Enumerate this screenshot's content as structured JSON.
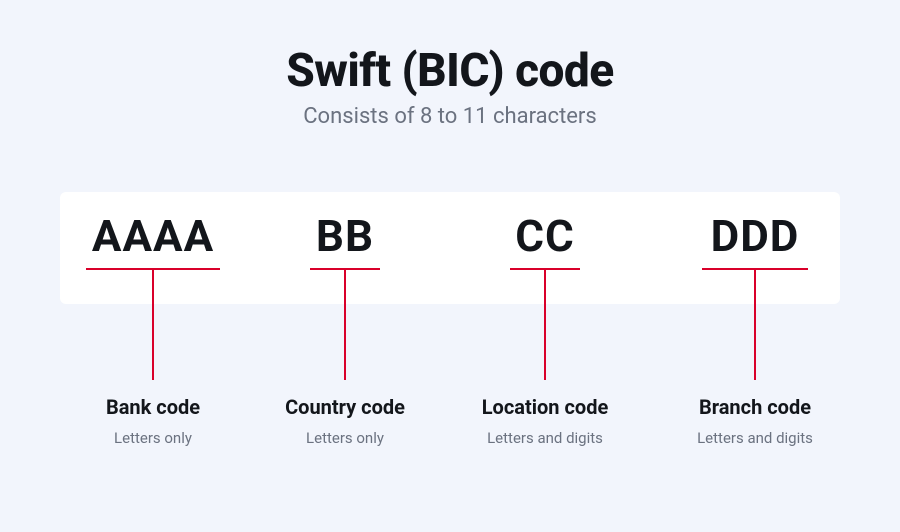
{
  "header": {
    "title": "Swift (BIC) code",
    "subtitle": "Consists of 8 to 11 characters"
  },
  "segments": [
    {
      "chars": "AAAA",
      "label": "Bank code",
      "desc": "Letters only"
    },
    {
      "chars": "BB",
      "label": "Country code",
      "desc": "Letters only"
    },
    {
      "chars": "CC",
      "label": "Location code",
      "desc": "Letters and digits"
    },
    {
      "chars": "DDD",
      "label": "Branch code",
      "desc": "Letters and digits"
    }
  ],
  "colors": {
    "accent": "#d9002a",
    "page_bg": "#f2f5fc",
    "card_bg": "#ffffff"
  }
}
